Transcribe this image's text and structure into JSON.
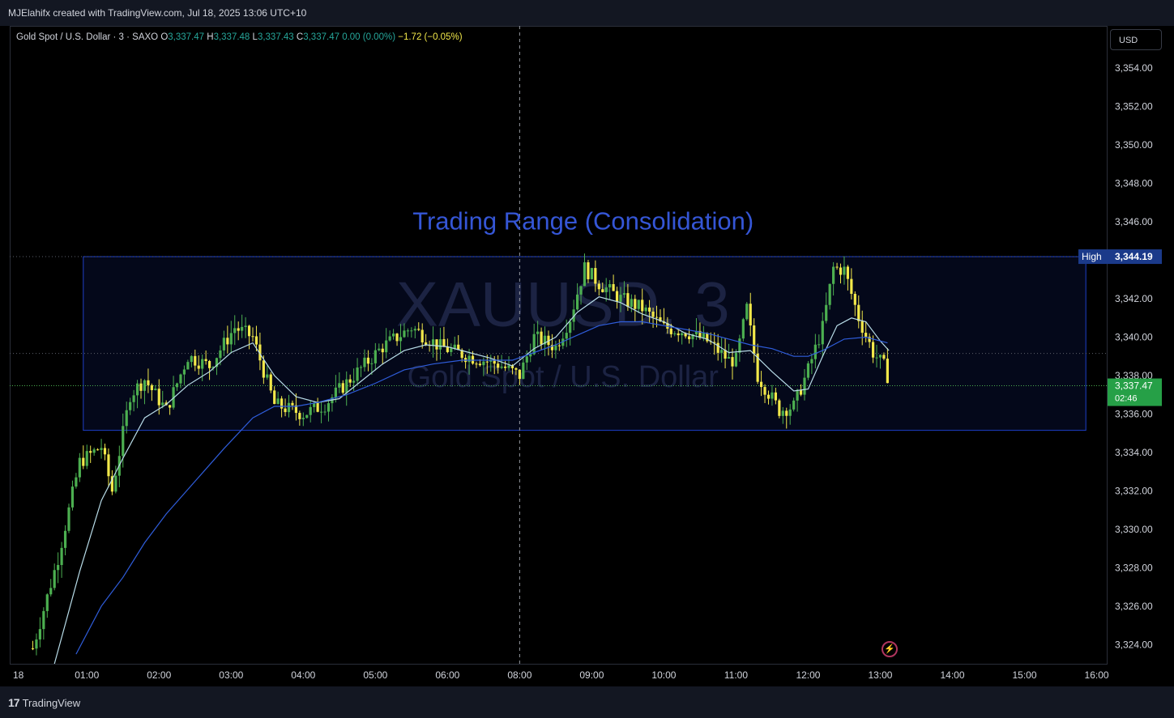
{
  "header": {
    "credit": "MJElahifx created with TradingView.com, Jul 18, 2025 13:06 UTC+10"
  },
  "legend": {
    "symbol": "Gold Spot / U.S. Dollar · 3 · SAXO",
    "o_label": "O",
    "o": "3,337.47",
    "h_label": "H",
    "h": "3,337.48",
    "l_label": "L",
    "l": "3,337.43",
    "c_label": "C",
    "c": "3,337.47",
    "change": "0.00 (0.00%)",
    "day_change": "−1.72 (−0.05%)"
  },
  "currency": "USD",
  "footer": {
    "brand": "TradingView"
  },
  "colors": {
    "up": "#26a69a",
    "up_fill": "#4caf50",
    "down": "#f2e84a",
    "range_box": "#1e40c8",
    "ma_fast": "#b8dce8",
    "ma_slow": "#2f5ddb"
  },
  "chart_data": {
    "type": "candlestick",
    "watermark_symbol": "XAUUSD, 3",
    "watermark_name": "Gold Spot / U.S. Dollar",
    "annotation": "Trading Range (Consolidation)",
    "range_box": {
      "top": 3344.19,
      "bottom": 3335.15,
      "label": "High",
      "label_value": "3,344.19"
    },
    "current_price": {
      "value": 3337.47,
      "label": "3,337.47",
      "countdown": "02:46"
    },
    "ylim": [
      3323.0,
      3356.2
    ],
    "yticks": [
      {
        "v": 3354,
        "label": "3,354.00"
      },
      {
        "v": 3352,
        "label": "3,352.00"
      },
      {
        "v": 3350,
        "label": "3,350.00"
      },
      {
        "v": 3348,
        "label": "3,348.00"
      },
      {
        "v": 3346,
        "label": "3,346.00"
      },
      {
        "v": 3342,
        "label": "3,342.00"
      },
      {
        "v": 3340,
        "label": "3,340.00"
      },
      {
        "v": 3338,
        "label": "3,338.00"
      },
      {
        "v": 3336,
        "label": "3,336.00"
      },
      {
        "v": 3334,
        "label": "3,334.00"
      },
      {
        "v": 3332,
        "label": "3,332.00"
      },
      {
        "v": 3330,
        "label": "3,330.00"
      },
      {
        "v": 3328,
        "label": "3,328.00"
      },
      {
        "v": 3326,
        "label": "3,326.00"
      },
      {
        "v": 3324,
        "label": "3,324.00"
      }
    ],
    "xlim_hours": [
      -0.07,
      15.14
    ],
    "xticks": [
      {
        "h": -0.07,
        "label": "18"
      },
      {
        "h": 1,
        "label": "01:00"
      },
      {
        "h": 2,
        "label": "02:00"
      },
      {
        "h": 3,
        "label": "03:00"
      },
      {
        "h": 4,
        "label": "04:00"
      },
      {
        "h": 5,
        "label": "05:00"
      },
      {
        "h": 6,
        "label": "06:00"
      },
      {
        "h": 7,
        "label": "08:00"
      },
      {
        "h": 8,
        "label": "09:00"
      },
      {
        "h": 9,
        "label": "10:00"
      },
      {
        "h": 10,
        "label": "11:00"
      },
      {
        "h": 11,
        "label": "12:00"
      },
      {
        "h": 12,
        "label": "13:00"
      },
      {
        "h": 13,
        "label": "14:00"
      },
      {
        "h": 14,
        "label": "15:00"
      },
      {
        "h": 15,
        "label": "16:00"
      }
    ],
    "session_break_hour": 7,
    "price_path": [
      [
        0.25,
        3323.8
      ],
      [
        0.6,
        3328.5
      ],
      [
        0.9,
        3333.5
      ],
      [
        1.2,
        3334.3
      ],
      [
        1.35,
        3332.0
      ],
      [
        1.6,
        3337.0
      ],
      [
        1.8,
        3337.8
      ],
      [
        2.1,
        3336.2
      ],
      [
        2.4,
        3339.0
      ],
      [
        2.7,
        3338.5
      ],
      [
        3.05,
        3340.5
      ],
      [
        3.3,
        3340.0
      ],
      [
        3.6,
        3336.5
      ],
      [
        4.0,
        3336.0
      ],
      [
        4.3,
        3336.5
      ],
      [
        4.7,
        3338.0
      ],
      [
        5.1,
        3339.5
      ],
      [
        5.5,
        3340.5
      ],
      [
        5.9,
        3339.5
      ],
      [
        6.3,
        3339.0
      ],
      [
        6.7,
        3338.6
      ],
      [
        7.0,
        3338.0
      ],
      [
        7.2,
        3340.0
      ],
      [
        7.5,
        3339.5
      ],
      [
        7.7,
        3341.0
      ],
      [
        7.9,
        3343.6
      ],
      [
        8.1,
        3342.8
      ],
      [
        8.4,
        3342.0
      ],
      [
        8.7,
        3341.5
      ],
      [
        9.0,
        3340.5
      ],
      [
        9.3,
        3340.3
      ],
      [
        9.6,
        3339.8
      ],
      [
        9.9,
        3338.8
      ],
      [
        10.0,
        3338.8
      ],
      [
        10.15,
        3341.5
      ],
      [
        10.3,
        3338.0
      ],
      [
        10.6,
        3336.2
      ],
      [
        10.8,
        3336.4
      ],
      [
        11.0,
        3338.3
      ],
      [
        11.2,
        3340.5
      ],
      [
        11.35,
        3343.6
      ],
      [
        11.5,
        3343.5
      ],
      [
        11.7,
        3341.0
      ],
      [
        11.9,
        3339.2
      ],
      [
        12.05,
        3338.5
      ],
      [
        12.15,
        3337.5
      ]
    ],
    "series": [
      {
        "name": "",
        "kind": "ma_fast",
        "x": [
          0.55,
          0.9,
          1.2,
          1.5,
          1.8,
          2.1,
          2.4,
          2.7,
          3.0,
          3.3,
          3.6,
          3.9,
          4.2,
          4.5,
          4.8,
          5.1,
          5.4,
          5.7,
          6.0,
          6.3,
          6.6,
          6.9,
          7.2,
          7.5,
          7.8,
          8.1,
          8.4,
          8.7,
          9.0,
          9.3,
          9.6,
          9.9,
          10.2,
          10.5,
          10.8,
          11.0,
          11.2,
          11.4,
          11.6,
          11.8,
          12.0,
          12.12
        ],
        "y": [
          3323.0,
          3327.8,
          3331.5,
          3333.7,
          3335.8,
          3336.5,
          3337.5,
          3338.2,
          3339.2,
          3339.7,
          3338.0,
          3336.9,
          3336.6,
          3336.8,
          3337.7,
          3338.6,
          3339.3,
          3339.6,
          3339.5,
          3339.2,
          3338.9,
          3338.5,
          3339.4,
          3340.0,
          3341.3,
          3342.1,
          3341.8,
          3341.2,
          3340.8,
          3340.2,
          3339.9,
          3339.2,
          3339.3,
          3338.2,
          3337.2,
          3337.3,
          3339.0,
          3340.6,
          3341.0,
          3340.8,
          3339.8,
          3339.3
        ]
      },
      {
        "name": "",
        "kind": "ma_slow",
        "x": [
          0.85,
          1.2,
          1.5,
          1.8,
          2.1,
          2.5,
          2.9,
          3.3,
          3.6,
          3.9,
          4.2,
          4.6,
          5.0,
          5.4,
          5.8,
          6.2,
          6.6,
          6.9,
          7.2,
          7.5,
          7.8,
          8.1,
          8.4,
          8.7,
          9.0,
          9.3,
          9.6,
          9.9,
          10.2,
          10.5,
          10.8,
          11.0,
          11.2,
          11.5,
          11.8,
          12.1
        ],
        "y": [
          3323.5,
          3326.0,
          3327.5,
          3329.3,
          3330.8,
          3332.5,
          3334.2,
          3335.8,
          3336.4,
          3336.4,
          3336.6,
          3337.0,
          3337.6,
          3338.3,
          3338.6,
          3338.8,
          3338.8,
          3338.8,
          3339.2,
          3339.6,
          3340.1,
          3340.6,
          3340.8,
          3340.8,
          3340.6,
          3340.4,
          3340.2,
          3339.9,
          3339.6,
          3339.4,
          3339.0,
          3339.0,
          3339.3,
          3339.9,
          3340.0,
          3339.7
        ]
      }
    ]
  }
}
